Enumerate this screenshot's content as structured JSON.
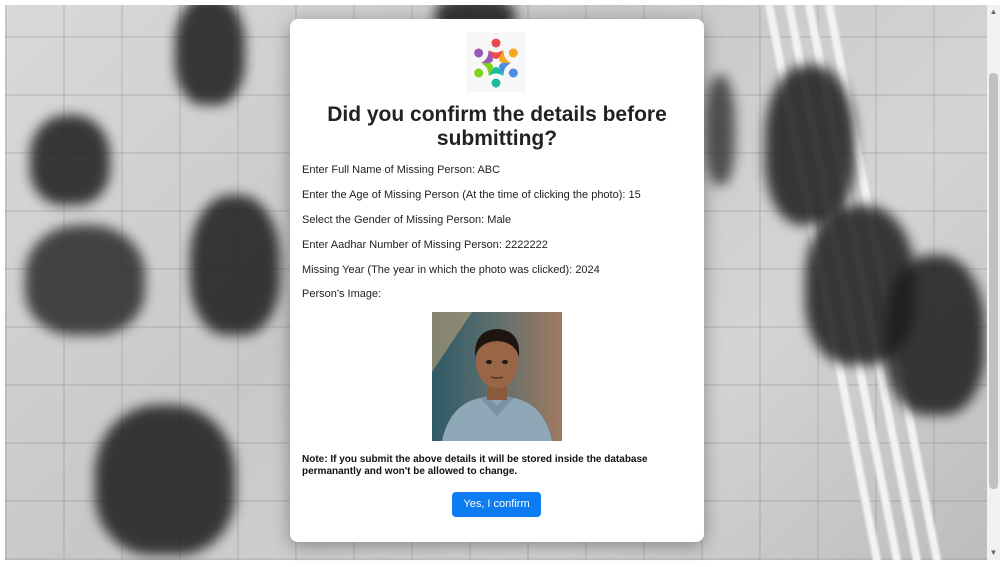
{
  "dialog": {
    "title": "Did you confirm the details before submitting?",
    "fields": [
      {
        "label": "Enter Full Name of Missing Person:",
        "value": "ABC"
      },
      {
        "label": "Enter the Age of Missing Person (At the time of clicking the photo):",
        "value": "15"
      },
      {
        "label": "Select the Gender of Missing Person:",
        "value": "Male"
      },
      {
        "label": "Enter Aadhar Number of Missing Person:",
        "value": "2222222"
      },
      {
        "label": "Missing Year (The year in which the photo was clicked):",
        "value": "2024"
      }
    ],
    "image_label": "Person's Image:",
    "note": "Note: If you submit the above details it will be stored inside the database permanantly and won't be allowed to change.",
    "confirm_label": "Yes, I confirm"
  },
  "icons": {
    "logo": "people-circle-logo-icon",
    "scroll_up": "arrow-up-icon",
    "scroll_down": "arrow-down-icon"
  },
  "colors": {
    "confirm_button": "#0d7cf2",
    "card_background": "#ffffff",
    "logo_colors": [
      "#e94b4b",
      "#f5a623",
      "#7ed321",
      "#4a90e2",
      "#9b59b6",
      "#1abc9c"
    ]
  }
}
